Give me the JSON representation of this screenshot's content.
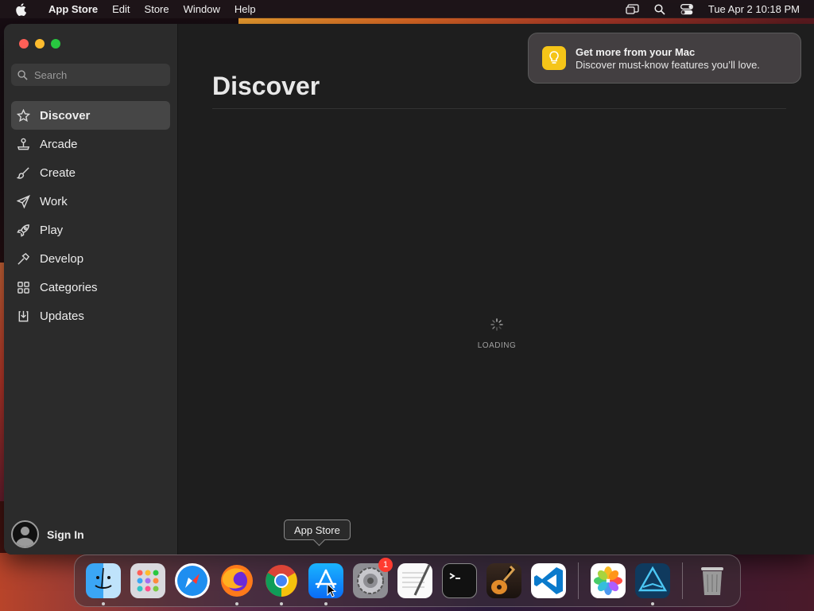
{
  "menubar": {
    "app_name": "App Store",
    "menus": [
      "Edit",
      "Store",
      "Window",
      "Help"
    ],
    "clock": "Tue Apr 2  10:18 PM"
  },
  "window": {
    "search": {
      "placeholder": "Search"
    },
    "sidebar": {
      "items": [
        {
          "label": "Discover",
          "icon": "star-icon",
          "active": true
        },
        {
          "label": "Arcade",
          "icon": "joystick-icon"
        },
        {
          "label": "Create",
          "icon": "brush-icon"
        },
        {
          "label": "Work",
          "icon": "paper-plane-icon"
        },
        {
          "label": "Play",
          "icon": "rocket-icon"
        },
        {
          "label": "Develop",
          "icon": "hammer-icon"
        },
        {
          "label": "Categories",
          "icon": "grid-icon"
        },
        {
          "label": "Updates",
          "icon": "download-icon"
        }
      ],
      "sign_in": "Sign In"
    },
    "main": {
      "title": "Discover",
      "loading": "LOADING"
    }
  },
  "notification": {
    "title": "Get more from your Mac",
    "body": "Discover must-know features you’ll love."
  },
  "tooltip": "App Store",
  "dock": {
    "items": [
      {
        "name": "Finder",
        "running": true
      },
      {
        "name": "Launchpad"
      },
      {
        "name": "Safari"
      },
      {
        "name": "Firefox",
        "running": true
      },
      {
        "name": "Chrome",
        "running": true
      },
      {
        "name": "App Store",
        "running": true
      },
      {
        "name": "System Settings",
        "badge": "1"
      },
      {
        "name": "TextEdit"
      },
      {
        "name": "Terminal"
      },
      {
        "name": "GarageBand"
      },
      {
        "name": "Visual Studio Code"
      },
      {
        "name": "Photos"
      },
      {
        "name": "Affinity Designer",
        "running": true
      },
      {
        "name": "Trash"
      }
    ]
  },
  "colors": {
    "close": "#fe5f57",
    "minimize": "#febc2e",
    "maximize": "#28c840",
    "badge": "#ff3b30",
    "notification_icon": "#f5c518"
  }
}
